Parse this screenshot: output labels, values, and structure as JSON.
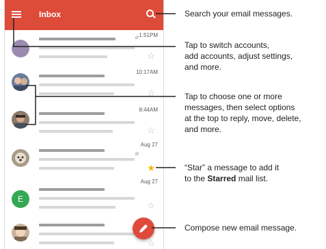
{
  "inbox": {
    "title": "Inbox",
    "messages": [
      {
        "time": "1:51PM",
        "starred": false,
        "attachment": true,
        "avatar": "letter",
        "letter": "",
        "avatar_color": "#9b8bb0"
      },
      {
        "time": "10:17AM",
        "starred": false,
        "attachment": false,
        "avatar": "photo"
      },
      {
        "time": "8:44AM",
        "starred": false,
        "attachment": false,
        "avatar": "photo"
      },
      {
        "time": "Aug 27",
        "starred": true,
        "attachment": true,
        "avatar": "photo"
      },
      {
        "time": "Aug 27",
        "starred": false,
        "attachment": false,
        "avatar": "letter",
        "letter": "E",
        "avatar_color": "#34a853"
      },
      {
        "time": "",
        "starred": false,
        "attachment": true,
        "avatar": "photo"
      }
    ]
  },
  "icons": {
    "menu": "menu-icon",
    "search": "search-icon",
    "star": "star-icon",
    "star_filled": "star-filled-icon",
    "attachment": "paperclip-icon",
    "compose": "pencil-icon"
  },
  "colors": {
    "appbar": "#dd4b39",
    "fab": "#e04a3a",
    "star_filled": "#f6b400"
  },
  "callouts": {
    "search": "Search your email messages.",
    "switch_line1": "Tap to switch accounts,",
    "switch_line2": "add accounts, adjust settings,",
    "switch_line3": "and more.",
    "choose_line1": "Tap to choose one or more",
    "choose_line2": "messages, then select options",
    "choose_line3": "at the top to reply, move, delete,",
    "choose_line4": "and more.",
    "star_line1": "“Star” a message to add it",
    "star_line2_pre": "to the ",
    "star_line2_bold": "Starred",
    "star_line2_post": " mail list.",
    "compose": "Compose new email message."
  }
}
